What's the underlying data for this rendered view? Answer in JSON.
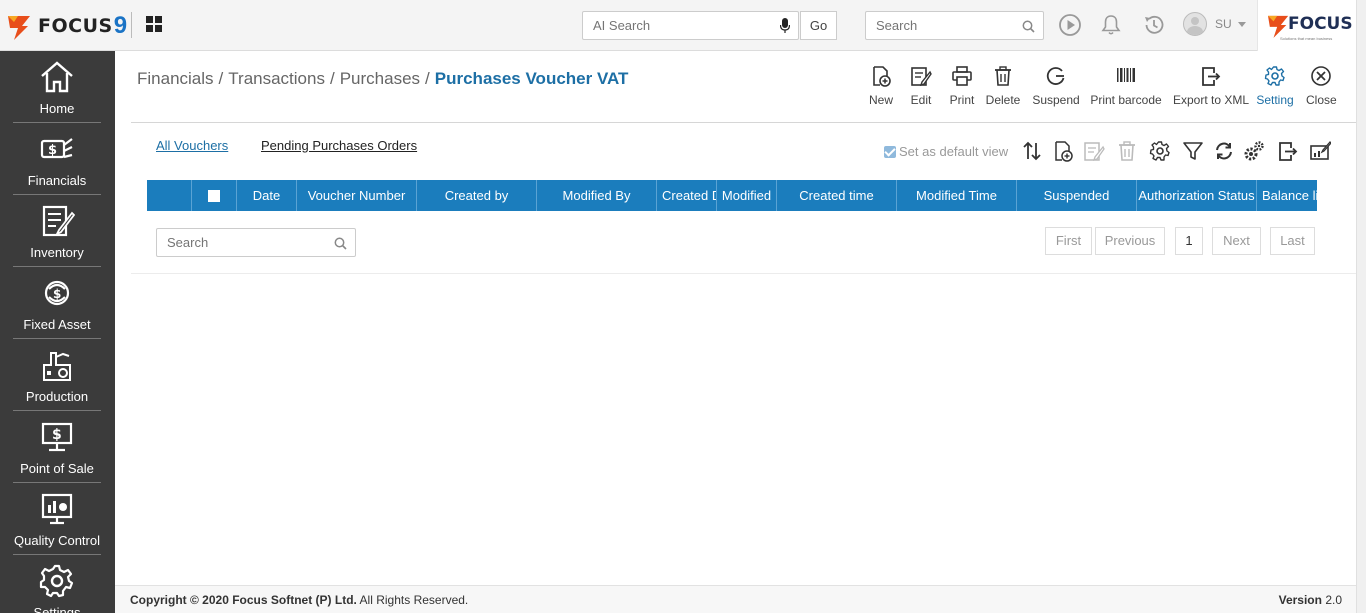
{
  "app": {
    "logo_text": "FOCUS",
    "logo_number": "9",
    "brand_text": "FOCUS",
    "brand_tagline": "Solutions that mean business"
  },
  "topbar": {
    "ai_search_placeholder": "AI Search",
    "go_label": "Go",
    "search_placeholder": "Search",
    "user_initials": "SU"
  },
  "sidebar": {
    "items": [
      {
        "label": "Home"
      },
      {
        "label": "Financials"
      },
      {
        "label": "Inventory"
      },
      {
        "label": "Fixed Asset"
      },
      {
        "label": "Production"
      },
      {
        "label": "Point of Sale"
      },
      {
        "label": "Quality Control"
      },
      {
        "label": "Settings"
      }
    ]
  },
  "breadcrumb": {
    "items": [
      "Financials",
      "Transactions",
      "Purchases"
    ],
    "separator": "/",
    "active": "Purchases Voucher VAT"
  },
  "toolbar": {
    "new": "New",
    "edit": "Edit",
    "print": "Print",
    "delete": "Delete",
    "suspend": "Suspend",
    "print_barcode": "Print barcode",
    "export_xml": "Export to XML",
    "setting": "Setting",
    "close": "Close"
  },
  "tabs": {
    "all_vouchers": "All Vouchers",
    "pending_po": "Pending Purchases Orders"
  },
  "view": {
    "default_view_label": "Set as default view",
    "default_view_checked": true
  },
  "table": {
    "columns": [
      "Date",
      "Voucher Number",
      "Created by",
      "Modified By",
      "Created D",
      "Modified",
      "Created time",
      "Modified Time",
      "Suspended",
      "Authorization Status",
      "Balance li"
    ],
    "rows": []
  },
  "grid": {
    "search_placeholder": "Search"
  },
  "pager": {
    "first": "First",
    "previous": "Previous",
    "current": "1",
    "next": "Next",
    "last": "Last"
  },
  "footer": {
    "copyright_prefix": "Copyright © 2020",
    "company": "Focus Softnet (P) Ltd.",
    "rights": "All Rights Reserved.",
    "version_label": "Version",
    "version_number": "2.0"
  },
  "colors": {
    "accent": "#1d6fa5",
    "table_header": "#1b7dbd",
    "sidebar": "#3b3b3b"
  }
}
